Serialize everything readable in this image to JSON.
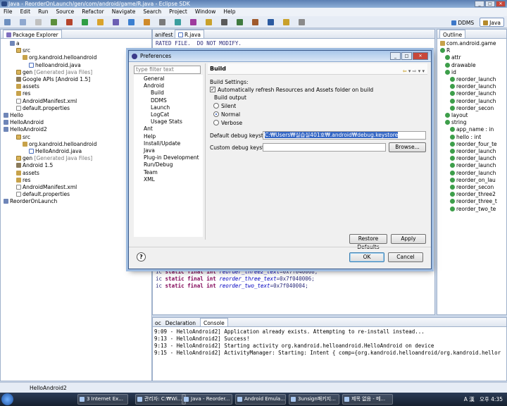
{
  "window": {
    "title": "Java - ReorderOnLaunch/gen/com/android/game/R.java - Eclipse SDK",
    "min": "_",
    "max": "□",
    "close": "✕"
  },
  "menu": [
    "File",
    "Edit",
    "Run",
    "Source",
    "Refactor",
    "Navigate",
    "Search",
    "Project",
    "Window",
    "Help"
  ],
  "perspectives": {
    "ddms": "DDMS",
    "java": "Java"
  },
  "package_explorer": {
    "tab": "Package Explorer",
    "tree": [
      {
        "label": "a",
        "indent": 1,
        "icon": "proj"
      },
      {
        "label": "src",
        "indent": 2,
        "icon": "src"
      },
      {
        "label": "org.kandroid.helloandroid",
        "indent": 3,
        "icon": "pkg"
      },
      {
        "label": "helloandroid.java",
        "indent": 4,
        "icon": "java"
      },
      {
        "label": "gen",
        "suffix": "[Generated Java Files]",
        "indent": 2,
        "icon": "src"
      },
      {
        "label": "Google APIs [Android 1.5]",
        "indent": 2,
        "icon": "lib"
      },
      {
        "label": "assets",
        "indent": 2,
        "icon": "pkg"
      },
      {
        "label": "res",
        "indent": 2,
        "icon": "pkg"
      },
      {
        "label": "AndroidManifest.xml",
        "indent": 2,
        "icon": "file"
      },
      {
        "label": "default.properties",
        "indent": 2,
        "icon": "file"
      },
      {
        "label": "Hello",
        "indent": 0,
        "icon": "proj"
      },
      {
        "label": "HelloAndroid",
        "indent": 0,
        "icon": "proj"
      },
      {
        "label": "HelloAndroid2",
        "indent": 0,
        "icon": "proj"
      },
      {
        "label": "src",
        "indent": 2,
        "icon": "src"
      },
      {
        "label": "org.kandroid.helloandroid",
        "indent": 3,
        "icon": "pkg"
      },
      {
        "label": "HelloAndroid.java",
        "indent": 4,
        "icon": "java"
      },
      {
        "label": "gen",
        "suffix": "[Generated Java Files]",
        "indent": 2,
        "icon": "src"
      },
      {
        "label": "Android 1.5",
        "indent": 2,
        "icon": "lib"
      },
      {
        "label": "assets",
        "indent": 2,
        "icon": "pkg"
      },
      {
        "label": "res",
        "indent": 2,
        "icon": "pkg"
      },
      {
        "label": "AndroidManifest.xml",
        "indent": 2,
        "icon": "file"
      },
      {
        "label": "default.properties",
        "indent": 2,
        "icon": "file"
      },
      {
        "label": "ReorderOnLaunch",
        "indent": 0,
        "icon": "proj"
      }
    ]
  },
  "editor": {
    "tabs": [
      "anifest",
      "R.java"
    ],
    "top_line": "RATED FILE.  DO NOT MODIFY.",
    "lines": [
      {
        "prefix": "ic ",
        "kw": "static final int ",
        "field": "reorder_three2_text",
        "value": "=0x7f040008;"
      },
      {
        "prefix": "ic ",
        "kw": "static final int ",
        "field": "reorder_three_text",
        "value": "=0x7f040006;"
      },
      {
        "prefix": "ic ",
        "kw": "static final int ",
        "field": "reorder_two_text",
        "value": "=0x7f040004;"
      }
    ]
  },
  "outline": {
    "tab": "Outline",
    "tree": [
      {
        "label": "com.android.game",
        "indent": 0,
        "icon": "pkg"
      },
      {
        "label": "R",
        "indent": 0,
        "icon": "cls"
      },
      {
        "label": "attr",
        "indent": 1,
        "icon": "cls"
      },
      {
        "label": "drawable",
        "indent": 1,
        "icon": "cls"
      },
      {
        "label": "id",
        "indent": 1,
        "icon": "cls"
      },
      {
        "label": "reorder_launch",
        "indent": 2,
        "icon": "fld"
      },
      {
        "label": "reorder_launch",
        "indent": 2,
        "icon": "fld"
      },
      {
        "label": "reorder_launch",
        "indent": 2,
        "icon": "fld"
      },
      {
        "label": "reorder_launch",
        "indent": 2,
        "icon": "fld"
      },
      {
        "label": "reorder_secon",
        "indent": 2,
        "icon": "fld"
      },
      {
        "label": "layout",
        "indent": 1,
        "icon": "cls"
      },
      {
        "label": "string",
        "indent": 1,
        "icon": "cls"
      },
      {
        "label": "app_name : in",
        "indent": 2,
        "icon": "fld"
      },
      {
        "label": "hello : int",
        "indent": 2,
        "icon": "fld"
      },
      {
        "label": "reorder_four_te",
        "indent": 2,
        "icon": "fld"
      },
      {
        "label": "reorder_launch",
        "indent": 2,
        "icon": "fld"
      },
      {
        "label": "reorder_launch",
        "indent": 2,
        "icon": "fld"
      },
      {
        "label": "reorder_launch",
        "indent": 2,
        "icon": "fld"
      },
      {
        "label": "reorder_launch",
        "indent": 2,
        "icon": "fld"
      },
      {
        "label": "reorder_on_lau",
        "indent": 2,
        "icon": "fld"
      },
      {
        "label": "reorder_secon",
        "indent": 2,
        "icon": "fld"
      },
      {
        "label": "reorder_three2",
        "indent": 2,
        "icon": "fld"
      },
      {
        "label": "reorder_three_t",
        "indent": 2,
        "icon": "fld"
      },
      {
        "label": "reorder_two_te",
        "indent": 2,
        "icon": "fld"
      }
    ]
  },
  "bottom": {
    "tabs": [
      "oc",
      "Declaration",
      "Console"
    ],
    "console_lines": [
      "9:09 - HelloAndroid2] Application already exists. Attempting to re-install instead...",
      "9:13 - HelloAndroid2] Success!",
      "9:13 - HelloAndroid2] Starting activity org.kandroid.helloandroid.HelloAndroid on device",
      "9:15 - HelloAndroid2] ActivityManager: Starting: Intent { comp={org.kandroid.helloandroid/org.kandroid.hellor"
    ]
  },
  "status": "HelloAndroid2",
  "dialog": {
    "title": "Preferences",
    "filter_placeholder": "type filter text",
    "nav": [
      {
        "label": "General",
        "level": 1
      },
      {
        "label": "Android",
        "level": 1
      },
      {
        "label": "Build",
        "level": 2
      },
      {
        "label": "DDMS",
        "level": 2
      },
      {
        "label": "Launch",
        "level": 2
      },
      {
        "label": "LogCat",
        "level": 2
      },
      {
        "label": "Usage Stats",
        "level": 2
      },
      {
        "label": "Ant",
        "level": 1
      },
      {
        "label": "Help",
        "level": 1
      },
      {
        "label": "Install/Update",
        "level": 1
      },
      {
        "label": "Java",
        "level": 1
      },
      {
        "label": "Plug-in Development",
        "level": 1
      },
      {
        "label": "Run/Debug",
        "level": 1
      },
      {
        "label": "Team",
        "level": 1
      },
      {
        "label": "XML",
        "level": 1
      }
    ],
    "page_title": "Build",
    "build_settings": "Build Settings:",
    "auto_refresh": "Automatically refresh Resources and Assets folder on build",
    "auto_refresh_checked": true,
    "build_output": "Build output",
    "radio_silent": "Silent",
    "radio_normal": "Normal",
    "radio_verbose": "Verbose",
    "selected_output": "Normal",
    "default_keystore_label": "Default debug keystore:",
    "default_keystore_value": "C:₩Users₩실습실401호₩.android₩debug.keystore",
    "custom_keystore_label": "Custom debug keystore:",
    "custom_keystore_value": "",
    "browse": "Browse...",
    "restore_defaults": "Restore Defaults",
    "apply": "Apply",
    "ok": "OK",
    "cancel": "Cancel",
    "help": "?"
  },
  "taskbar": {
    "tasks": [
      "3 Internet Ex...",
      "관리자: C:₩Wi...",
      "Java - Reorder...",
      "Android Emula...",
      "3unsign패키지...",
      "제목 없음 - 메..."
    ],
    "tray_lang": "A 漢",
    "clock": "오후 4:35"
  }
}
